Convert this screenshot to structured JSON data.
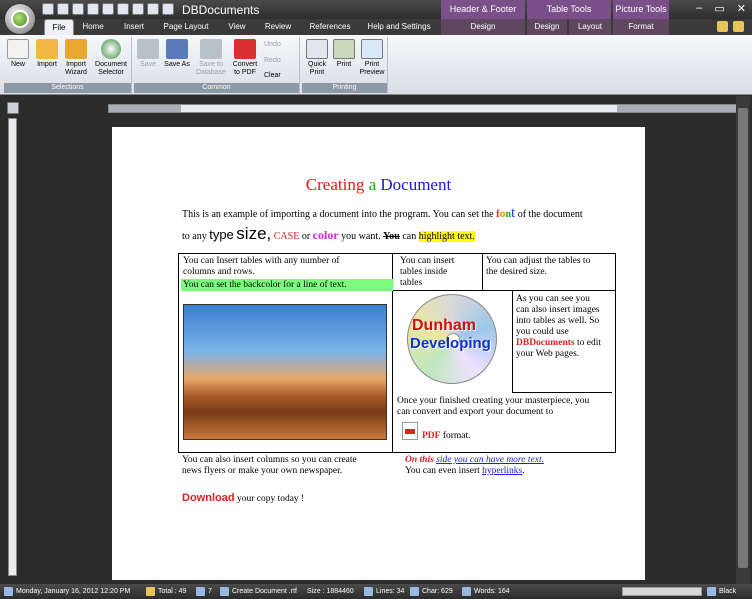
{
  "app": {
    "title": "DBDocuments",
    "context_groups": [
      "Header & Footer Tools",
      "Table Tools",
      "Picture Tools"
    ]
  },
  "tabs": [
    "File",
    "Home",
    "Insert",
    "Page Layout",
    "View",
    "Review",
    "References",
    "Help and Settings",
    "Design",
    "Design",
    "Layout",
    "Format"
  ],
  "ribbon": {
    "selections": {
      "label": "Selections",
      "buttons": [
        "New",
        "Import",
        "Import Wizard",
        "Document Selector"
      ]
    },
    "common": {
      "label": "Common",
      "buttons": [
        "Save",
        "Save As",
        "Save to Database",
        "Convert to PDF"
      ],
      "small": [
        "Undo",
        "Redo",
        "Clear"
      ]
    },
    "printing": {
      "label": "Printing",
      "buttons": [
        "Quick Print",
        "Print",
        "Print Preview"
      ]
    }
  },
  "document": {
    "title_parts": [
      "Creating",
      "a",
      "Document"
    ],
    "title_colors": [
      "#e81818",
      "#18a818",
      "#1818e8"
    ],
    "para1": {
      "before": "This is an example of importing a document into the program. You can set the ",
      "font_word_f": "f",
      "font_word_o": "o",
      "font_word_n": "n",
      "font_word_t": "t",
      "after": " of the document"
    },
    "para2": {
      "prefix": "to any",
      "type": "type",
      "size": "size,",
      "case": "CASE",
      "or": "or",
      "color": "color",
      "you_want": "you want.",
      "you_strike": "You",
      "can": "can",
      "highlight": "highlight text."
    },
    "table": {
      "c1_line1": "You can Insert tables with any number of",
      "c1_line2": "columns and rows.",
      "c1_green": "You can set the backcolor for a line of text.",
      "c2_line1": "You can insert",
      "c2_line2": "tables inside",
      "c2_line3": "tables",
      "c3_line1": "You can adjust the tables to",
      "c3_line2": "the desired size.",
      "logo_line1": "Dunham",
      "logo_line2": "Developing",
      "img_text_1": "As you can see you",
      "img_text_2": "can also insert images",
      "img_text_3": "into tables as well. So",
      "img_text_4": "you could use",
      "img_text_brand": "DBDocuments",
      "img_text_5": "to edit",
      "img_text_6": "your Web pages.",
      "conv_line1": "Once your finished creating your masterpiece, you",
      "conv_line2": "can convert and export your document to",
      "pdf": "PDF",
      "format": "format."
    },
    "columns": {
      "left1": "You can also insert columns so you can create",
      "left2": "news  flyers or make your own newspaper.",
      "right1_red": "On this",
      "right1_link": "side you can have more text.",
      "right2": "You can even insert",
      "right2_link": "hyperlinks",
      "right2_end": "."
    },
    "download": {
      "word": "Download",
      "rest": "your copy today !"
    }
  },
  "status": {
    "datetime": "Monday, January 16, 2012 12:20 PM",
    "total": "Total : 49",
    "count": "7",
    "file": "Create Document .rtf",
    "size": "Size : 1884460",
    "lines": "Lines: 34",
    "chars": "Char: 629",
    "words": "Words: 164",
    "theme": "Black"
  }
}
